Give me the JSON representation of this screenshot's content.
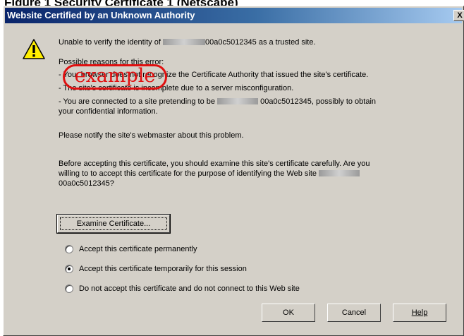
{
  "figure_heading": "Figure 1 Security Certificate 1 (Netscape)",
  "dialog": {
    "title": "Website Certified by an Unknown Authority",
    "close_glyph": "X"
  },
  "message": {
    "intro_prefix": "Unable to verify the identity of",
    "intro_suffix": "00a0c5012345 as a trusted site.",
    "reasons_heading": "Possible reasons for this error:",
    "reason_1": "- Your browser does not recognize the Certificate Authority that issued the site's certificate.",
    "reason_2": "- The site's certificate is incomplete due to a server misconfiguration.",
    "reason_3_prefix": "- You are connected to a site pretending to be",
    "reason_3_suffix": "00a0c5012345, possibly to obtain",
    "reason_3_line2": "your confidential information.",
    "notify": "Please notify the site's webmaster about this problem.",
    "before_line1": "Before accepting this certificate, you should examine this site's certificate carefully. Are you",
    "before_line2": "willing to to accept this certificate for the purpose of identifying the Web site",
    "before_line3": "00a0c5012345?"
  },
  "stamp_text": "example",
  "examine_button_label": "Examine Certificate...",
  "options": [
    {
      "label": "Accept this certificate permanently",
      "selected": false
    },
    {
      "label": "Accept this certificate temporarily for this session",
      "selected": true
    },
    {
      "label": "Do not accept this certificate and do not connect to this Web site",
      "selected": false
    }
  ],
  "buttons": {
    "ok": "OK",
    "cancel": "Cancel",
    "help": "Help"
  },
  "icon": "warning-triangle-icon"
}
